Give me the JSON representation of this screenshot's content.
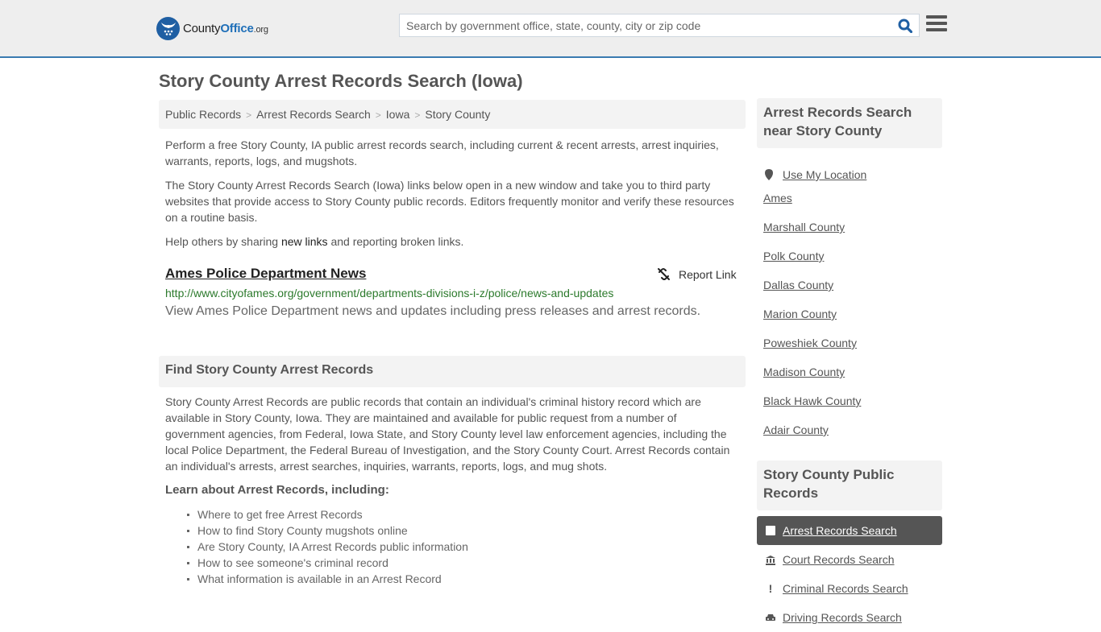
{
  "header": {
    "logo": {
      "name_main": "County",
      "name_accent": "Office",
      "name_tld": ".org",
      "icon": "eagle-stars-icon"
    },
    "search": {
      "placeholder": "Search by government office, state, county, city or zip code",
      "value": "",
      "icon": "search-icon"
    },
    "menu_icon": "hamburger-menu-icon"
  },
  "page": {
    "title": "Story County Arrest Records Search (Iowa)",
    "breadcrumb": [
      "Public Records",
      "Arrest Records Search",
      "Iowa",
      "Story County"
    ],
    "breadcrumb_separator": ">",
    "intro": "Perform a free Story County, IA public arrest records search, including current & recent arrests, arrest inquiries, warrants, reports, logs, and mugshots.",
    "disclaimer": "The Story County Arrest Records Search (Iowa) links below open in a new window and take you to third party websites that provide access to Story County public records. Editors frequently monitor and verify these resources on a routine basis.",
    "help_prefix": "Help others by sharing ",
    "help_link": "new links",
    "help_suffix": " and reporting broken links."
  },
  "results": [
    {
      "title": "Ames Police Department News",
      "url": "http://www.cityofames.org/government/departments-divisions-i-z/police/news-and-updates",
      "description": "View Ames Police Department news and updates including press releases and arrest records.",
      "report_label": "Report Link",
      "report_icon": "broken-link-icon"
    }
  ],
  "find_section": {
    "heading": "Find Story County Arrest Records",
    "body": "Story County Arrest Records are public records that contain an individual's criminal history record which are available in Story County, Iowa. They are maintained and available for public request from a number of government agencies, from Federal, Iowa State, and Story County level law enforcement agencies, including the local Police Department, the Federal Bureau of Investigation, and the Story County Court. Arrest Records contain an individual's arrests, arrest searches, inquiries, warrants, reports, logs, and mug shots.",
    "learn_heading": "Learn about Arrest Records, including:",
    "learn_items": [
      "Where to get free Arrest Records",
      "How to find Story County mugshots online",
      "Are Story County, IA Arrest Records public information",
      "How to see someone's criminal record",
      "What information is available in an Arrest Record"
    ]
  },
  "sidebar": {
    "near_heading": "Arrest Records Search near Story County",
    "use_location": "Use My Location",
    "near_items": [
      "Ames",
      "Marshall County",
      "Polk County",
      "Dallas County",
      "Marion County",
      "Poweshiek County",
      "Madison County",
      "Black Hawk County",
      "Adair County"
    ],
    "records_heading": "Story County Public Records",
    "records_items": [
      {
        "label": "Arrest Records Search",
        "icon": "square-icon",
        "active": true
      },
      {
        "label": "Court Records Search",
        "icon": "courthouse-icon",
        "active": false
      },
      {
        "label": "Criminal Records Search",
        "icon": "exclamation-icon",
        "active": false
      },
      {
        "label": "Driving Records Search",
        "icon": "car-icon",
        "active": false
      }
    ]
  },
  "colors": {
    "accent_blue": "#3a7bb0",
    "logo_blue": "#1f5fa3",
    "url_green": "#2c7a2c",
    "active_bg": "#555555"
  }
}
